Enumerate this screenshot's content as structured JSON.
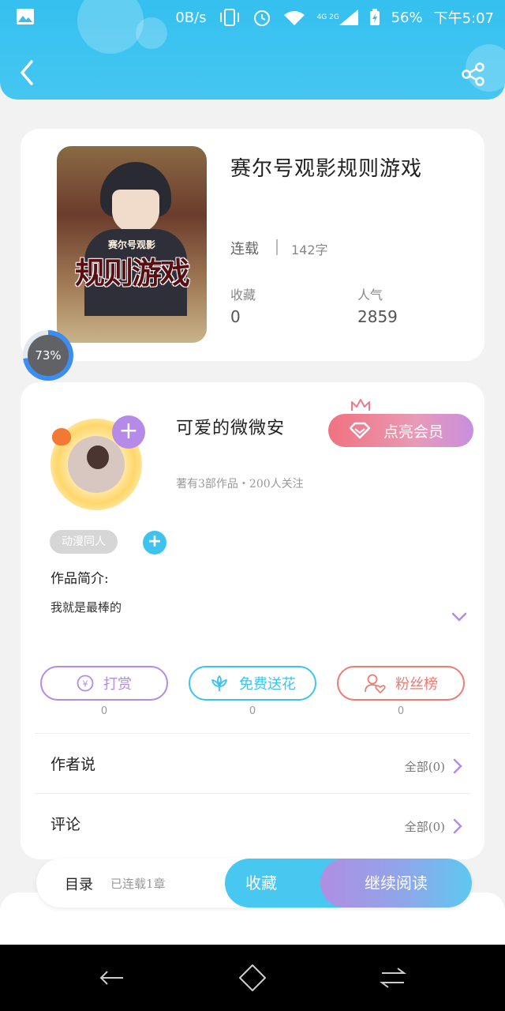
{
  "status_bar": {
    "net_speed": "0B/s",
    "signal_label": "4G 2G",
    "battery": "56%",
    "time": "下午5:07"
  },
  "header": {
    "back_icon": "back-arrow-icon",
    "share_icon": "share-icon"
  },
  "book": {
    "cover_subtitle": "赛尔号观影",
    "cover_title": "规则游戏",
    "title": "赛尔号观影规则游戏",
    "status": "连载",
    "word_count": "142字",
    "favorites_label": "收藏",
    "favorites_value": "0",
    "popularity_label": "人气",
    "popularity_value": "2859",
    "progress_percent": 73,
    "progress_label": "73%"
  },
  "author": {
    "name": "可爱的微微安",
    "meta": "著有3部作品・200人关注",
    "vip_label": "点亮会员",
    "tag": "动漫同人",
    "intro_label": "作品简介:",
    "intro_text": "我就是最棒的"
  },
  "actions": [
    {
      "label": "打赏",
      "count": "0",
      "color": "#b58ae8",
      "icon": "yen-coin-icon"
    },
    {
      "label": "免费送花",
      "count": "0",
      "color": "#3ec3ef",
      "icon": "flower-icon"
    },
    {
      "label": "粉丝榜",
      "count": "0",
      "color": "#ee7a72",
      "icon": "fans-rank-icon"
    }
  ],
  "sections": {
    "author_says": {
      "title": "作者说",
      "all": "全部(0)"
    },
    "comments": {
      "title": "评论",
      "all": "全部(0)"
    }
  },
  "bottom": {
    "toc_label": "目录",
    "toc_status": "已连载1章",
    "favorite_button": "收藏",
    "read_button": "继续阅读"
  },
  "colors": {
    "header_blue": "#35c0ef",
    "accent_purple": "#b58ae8",
    "accent_cyan": "#3ec3ef",
    "accent_red": "#ee7a72"
  }
}
